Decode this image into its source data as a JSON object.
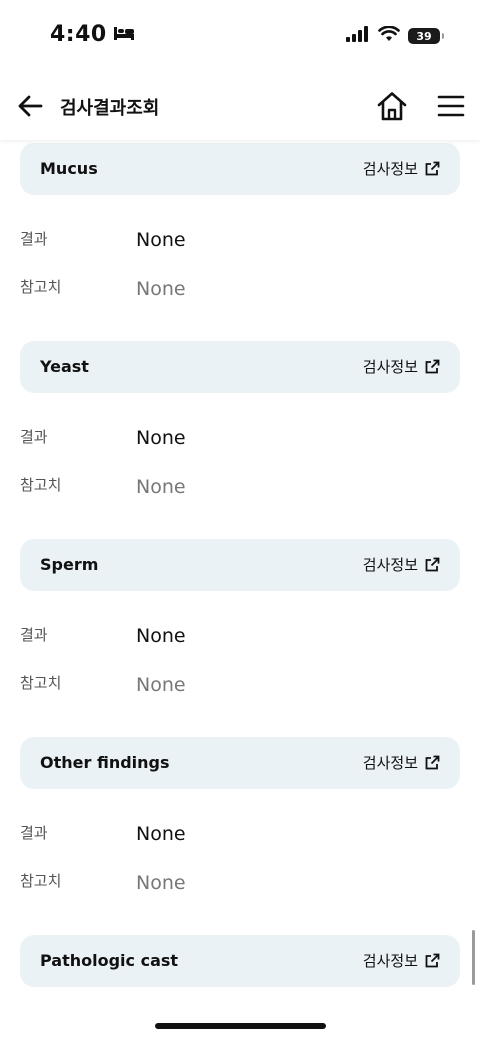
{
  "status": {
    "time": "4:40",
    "battery": "39"
  },
  "header": {
    "title": "검사결과조회"
  },
  "labels": {
    "result": "결과",
    "reference": "참고치",
    "info_link": "검사정보"
  },
  "sections": [
    {
      "title": "Mucus",
      "result": "None",
      "reference": "None"
    },
    {
      "title": "Yeast",
      "result": "None",
      "reference": "None"
    },
    {
      "title": "Sperm",
      "result": "None",
      "reference": "None"
    },
    {
      "title": "Other findings",
      "result": "None",
      "reference": "None"
    },
    {
      "title": "Pathologic cast"
    }
  ]
}
